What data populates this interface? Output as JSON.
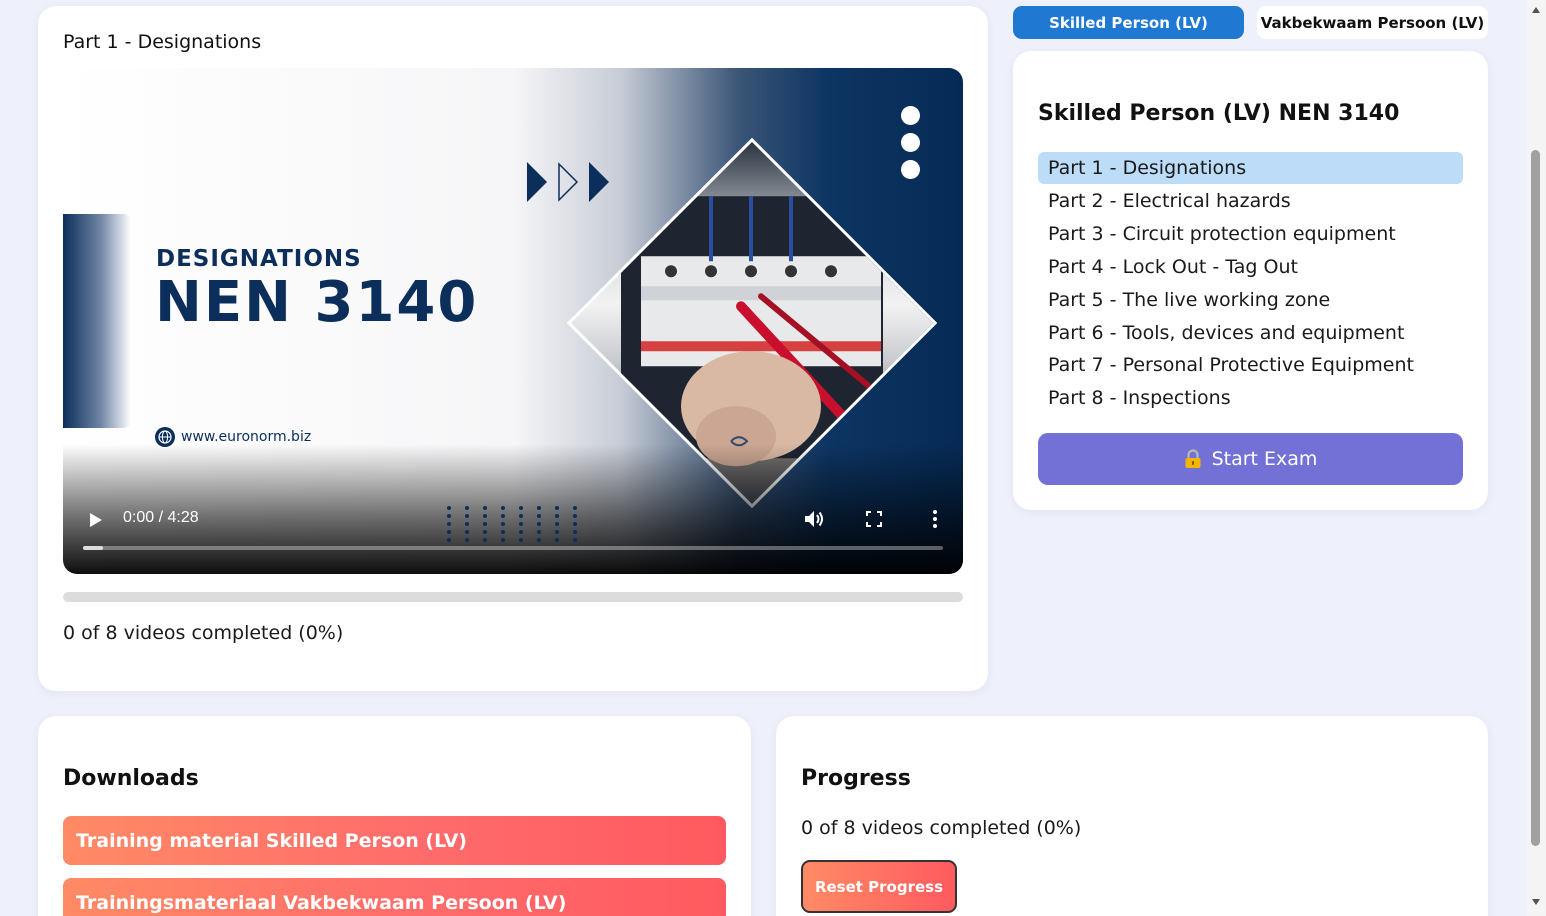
{
  "video": {
    "title": "Part 1 - Designations",
    "thumbnail_heading": "DESIGNATIONS",
    "thumbnail_subheading": "NEN 3140",
    "thumbnail_url": "www.euronorm.biz",
    "time": "0:00 / 4:28",
    "playback_progress": 0
  },
  "main_progress": {
    "text": "0 of 8 videos completed (0%)",
    "percent": 0
  },
  "tabs": {
    "skilled": "Skilled Person (LV)",
    "vakbekwaam": "Vakbekwaam Persoon (LV)"
  },
  "parts": {
    "title": "Skilled Person (LV) NEN 3140",
    "items": [
      "Part 1 - Designations",
      "Part 2 - Electrical hazards",
      "Part 3 - Circuit protection equipment",
      "Part 4 - Lock Out - Tag Out",
      "Part 5 - The live working zone",
      "Part 6 - Tools, devices and equipment",
      "Part 7 - Personal Protective Equipment",
      "Part 8 - Inspections"
    ],
    "active_index": 0,
    "start_exam_icon": "lock-icon",
    "start_exam_label": "Start Exam"
  },
  "downloads": {
    "title": "Downloads",
    "items": [
      "Training material Skilled Person (LV)",
      "Trainingsmateriaal Vakbekwaam Persoon (LV)"
    ]
  },
  "progress": {
    "title": "Progress",
    "text": "0 of 8 videos completed (0%)",
    "reset_label": "Reset Progress"
  },
  "colors": {
    "accent_blue": "#1f78d1",
    "active_item": "#bcdcf8",
    "exam_button": "#7370d6",
    "download_gradient_start": "#ff8a65",
    "download_gradient_end": "#ff5a5f",
    "navy": "#0b2e5b"
  }
}
